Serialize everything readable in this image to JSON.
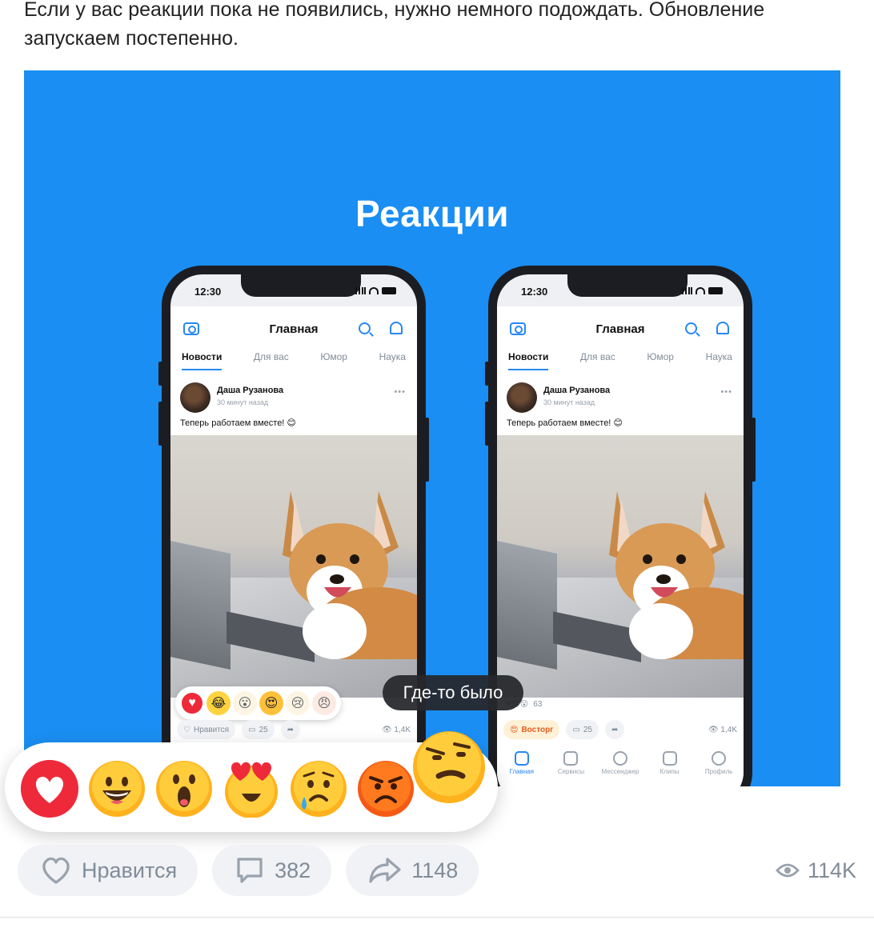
{
  "post": {
    "text_line1": "Если у вас реакции пока не появились, нужно немного подождать. Обновление",
    "text_line2": "запускаем постепенно."
  },
  "banner": {
    "title": "Реакции",
    "background_color": "#1a8ef2"
  },
  "phone": {
    "status_time": "12:30",
    "header_title": "Главная",
    "tabs": [
      "Новости",
      "Для вас",
      "Юмор",
      "Наука"
    ],
    "author": "Даша Рузанова",
    "post_time": "30 минут назад",
    "caption": "Теперь работаем вместе! 😊",
    "like_label": "Нравится",
    "comments": "25",
    "views": "1,4K",
    "reaction_label": "Восторг",
    "reaction_count": "63",
    "nav": [
      "Главная",
      "Сервисы",
      "Мессенджер",
      "Клипы",
      "Профиль"
    ]
  },
  "tooltip": "Где-то было",
  "reactions": [
    "heart",
    "laughing",
    "surprised",
    "heart-eyes",
    "crying",
    "angry",
    "sceptical"
  ],
  "actions": {
    "like_label": "Нравится",
    "comments_count": "382",
    "shares_count": "1148",
    "views_count": "114K"
  }
}
